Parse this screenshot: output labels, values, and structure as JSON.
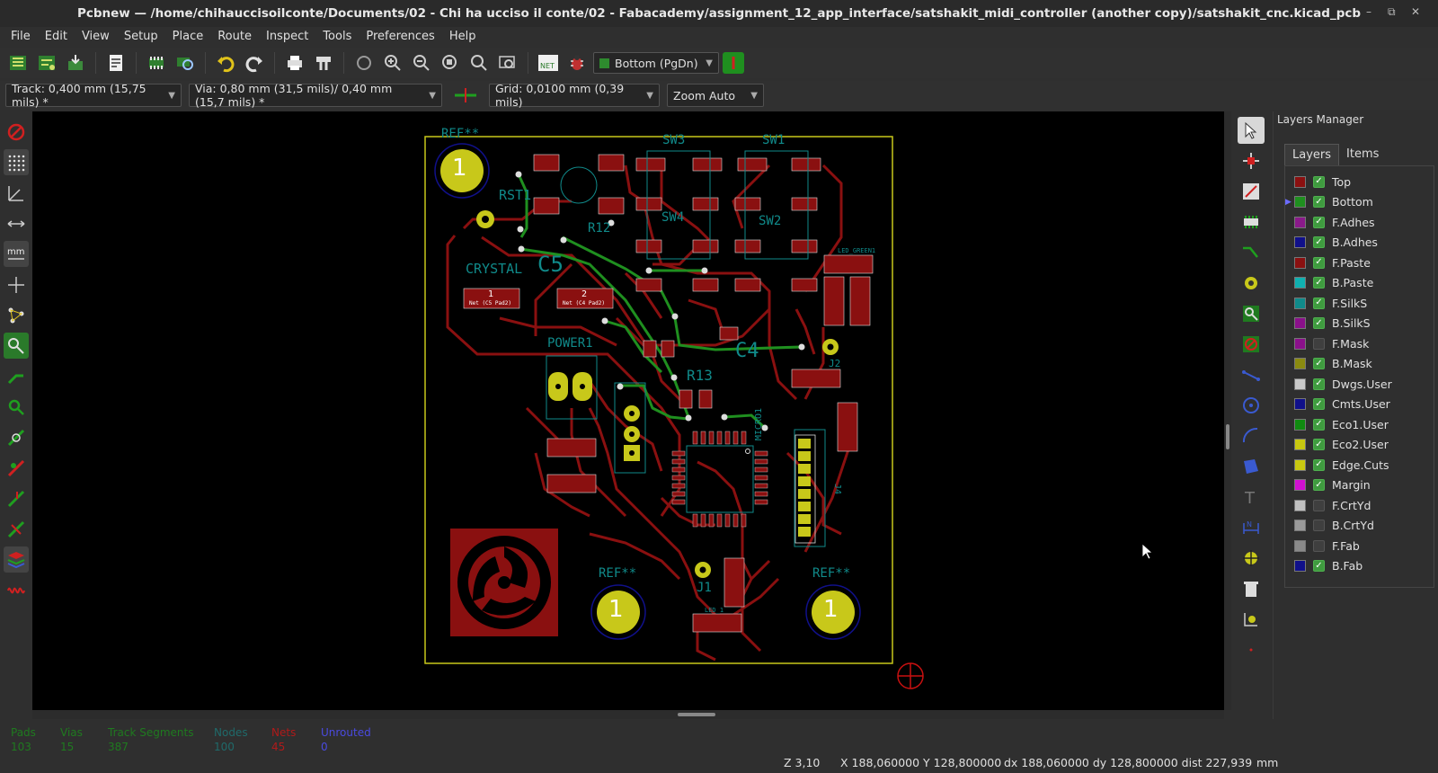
{
  "window": {
    "title": "Pcbnew — /home/chihauccisoilconte/Documents/02 - Chi ha ucciso il conte/02 - Fabacademy/assignment_12_app_interface/satshakit_midi_controller (another copy)/satshakit_cnc.kicad_pcb"
  },
  "menu": [
    "File",
    "Edit",
    "View",
    "Setup",
    "Place",
    "Route",
    "Inspect",
    "Tools",
    "Preferences",
    "Help"
  ],
  "toolbar": {
    "active_layer": "Bottom (PgDn)",
    "active_layer_color": "#2e8b2e"
  },
  "aux": {
    "track": "Track: 0,400 mm (15,75 mils) *",
    "via": "Via: 0,80 mm (31,5 mils)/ 0,40 mm (15,7 mils) *",
    "grid": "Grid: 0,0100 mm (0,39 mils)",
    "zoom": "Zoom Auto"
  },
  "pcb": {
    "labels": {
      "ref_top_left": "REF**",
      "sw3": "SW3",
      "sw1": "SW1",
      "rst1": "RST1",
      "crystal": "CRYSTAL",
      "c5": "C5",
      "sw4": "SW4",
      "sw2": "SW2",
      "power1": "POWER1",
      "r13": "R13",
      "r12": "R12",
      "ic4": "C4",
      "j2": "J2",
      "micro1": "MICRO1",
      "ref_bottom_mid": "REF**",
      "ref_bottom_right": "REF**",
      "j1": "J1",
      "led_green": "LED_GREEN1",
      "led1": "LED_1",
      "j4": "J4",
      "pad1_label": "1",
      "pad1_net": "Net (C5 Pad2)",
      "pad2_label": "2",
      "pad2_net": "Net (C4 Pad2)",
      "mh": "1"
    }
  },
  "layers_manager": {
    "title": "Layers Manager",
    "tabs": [
      "Layers",
      "Items"
    ],
    "active_layer": "Bottom",
    "layers": [
      {
        "name": "Top",
        "color": "#8b1010",
        "visible": true
      },
      {
        "name": "Bottom",
        "color": "#1f8f1f",
        "visible": true
      },
      {
        "name": "F.Adhes",
        "color": "#8a1a8a",
        "visible": true
      },
      {
        "name": "B.Adhes",
        "color": "#10108a",
        "visible": true
      },
      {
        "name": "F.Paste",
        "color": "#8a1010",
        "visible": true
      },
      {
        "name": "B.Paste",
        "color": "#10b0b0",
        "visible": true
      },
      {
        "name": "F.SilkS",
        "color": "#108a8a",
        "visible": true
      },
      {
        "name": "B.SilkS",
        "color": "#8a108a",
        "visible": true
      },
      {
        "name": "F.Mask",
        "color": "#8a108a",
        "visible": false
      },
      {
        "name": "B.Mask",
        "color": "#8a8a10",
        "visible": true
      },
      {
        "name": "Dwgs.User",
        "color": "#c8c8c8",
        "visible": true
      },
      {
        "name": "Cmts.User",
        "color": "#10108a",
        "visible": true
      },
      {
        "name": "Eco1.User",
        "color": "#108a10",
        "visible": true
      },
      {
        "name": "Eco2.User",
        "color": "#c8c810",
        "visible": true
      },
      {
        "name": "Edge.Cuts",
        "color": "#c8c810",
        "visible": true
      },
      {
        "name": "Margin",
        "color": "#d010d0",
        "visible": true
      },
      {
        "name": "F.CrtYd",
        "color": "#c0c0c0",
        "visible": false
      },
      {
        "name": "B.CrtYd",
        "color": "#9a9a9a",
        "visible": false
      },
      {
        "name": "F.Fab",
        "color": "#8a8a8a",
        "visible": false
      },
      {
        "name": "B.Fab",
        "color": "#10108a",
        "visible": true
      }
    ]
  },
  "messages": [
    {
      "label": "Pads",
      "value": "103",
      "color": "#1f7a1f"
    },
    {
      "label": "Vias",
      "value": "15",
      "color": "#1f7a1f"
    },
    {
      "label": "Track Segments",
      "value": "387",
      "color": "#1f7a1f"
    },
    {
      "label": "Nodes",
      "value": "100",
      "color": "#1f6a6a"
    },
    {
      "label": "Nets",
      "value": "45",
      "color": "#9a1a1a"
    },
    {
      "label": "Unrouted",
      "value": "0",
      "color": "#3a3ad0"
    }
  ],
  "status": {
    "zoom": "Z 3,10",
    "xy": "X 188,060000  Y 128,800000",
    "delta": "dx 188,060000  dy 128,800000  dist 227,939",
    "units": "mm"
  }
}
